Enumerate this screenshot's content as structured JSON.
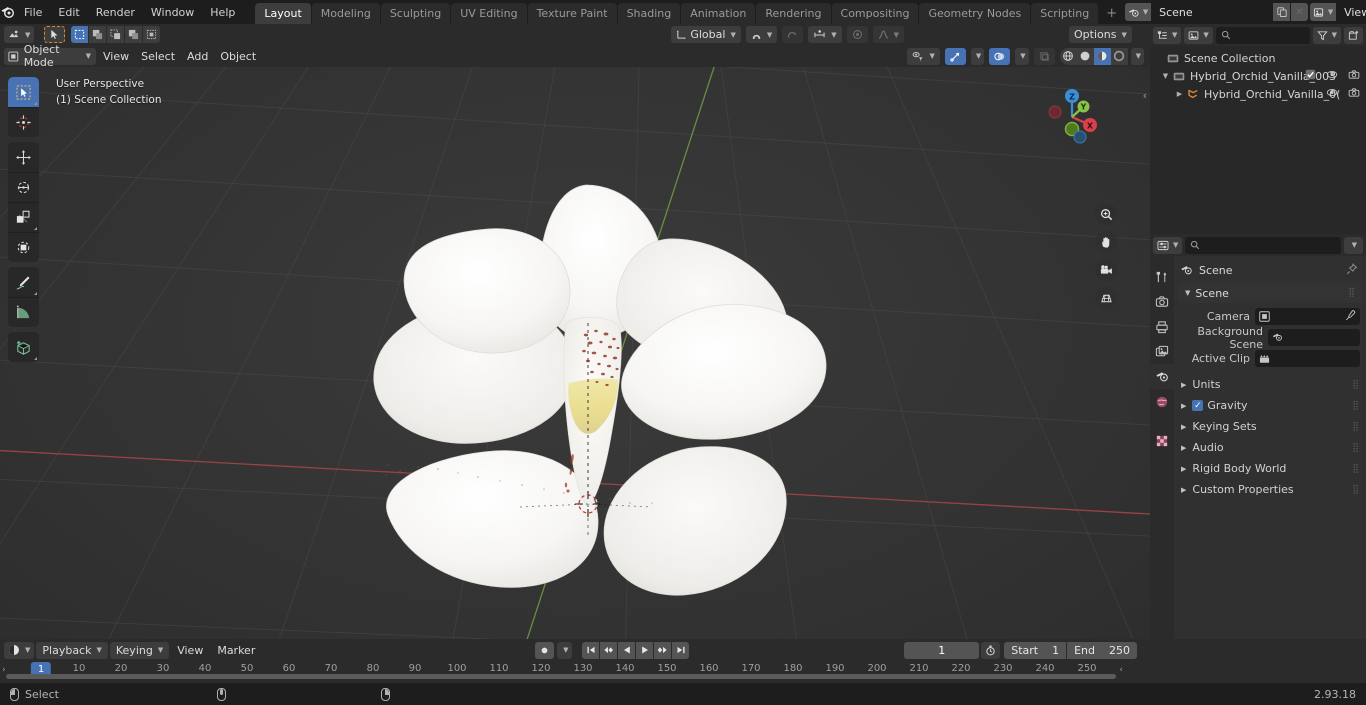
{
  "app": {
    "name": "Blender",
    "version": "2.93.18"
  },
  "topbar": {
    "menus": [
      "File",
      "Edit",
      "Render",
      "Window",
      "Help"
    ],
    "workspace_tabs": [
      {
        "label": "Layout",
        "active": true
      },
      {
        "label": "Modeling",
        "active": false
      },
      {
        "label": "Sculpting",
        "active": false
      },
      {
        "label": "UV Editing",
        "active": false
      },
      {
        "label": "Texture Paint",
        "active": false
      },
      {
        "label": "Shading",
        "active": false
      },
      {
        "label": "Animation",
        "active": false
      },
      {
        "label": "Rendering",
        "active": false
      },
      {
        "label": "Compositing",
        "active": false
      },
      {
        "label": "Geometry Nodes",
        "active": false
      },
      {
        "label": "Scripting",
        "active": false
      },
      {
        "label": "+",
        "active": false
      }
    ],
    "scene_name": "Scene",
    "view_layer_name": "View Layer"
  },
  "viewport_header": {
    "mode": "Object Mode",
    "menus": [
      "View",
      "Select",
      "Add",
      "Object"
    ],
    "transform_orientation": "Global",
    "options_label": "Options"
  },
  "viewport": {
    "perspective_label": "User Perspective",
    "collection_label": "(1) Scene Collection",
    "gizmo_axes": [
      "X",
      "Y",
      "Z"
    ],
    "axis_colors": {
      "x": "#d9414c",
      "y": "#8bc34a",
      "z": "#3b8fd9"
    }
  },
  "toolbar": {
    "tools": [
      {
        "name": "tweak-select-box",
        "active": true
      },
      {
        "name": "cursor",
        "active": false
      },
      {
        "name": "move",
        "active": false
      },
      {
        "name": "rotate",
        "active": false
      },
      {
        "name": "scale",
        "active": false
      },
      {
        "name": "transform",
        "active": false
      },
      {
        "name": "annotate",
        "active": false
      },
      {
        "name": "measure",
        "active": false
      },
      {
        "name": "add-cube",
        "active": false
      }
    ]
  },
  "outliner": {
    "search_placeholder": "",
    "rows": [
      {
        "label": "Scene Collection",
        "indent": 0,
        "icon": "collection",
        "expandable": false,
        "checkbox": false,
        "eye": false,
        "camera": false
      },
      {
        "label": "Hybrid_Orchid_Vanilla_003",
        "indent": 1,
        "icon": "collection",
        "expandable": true,
        "expanded": true,
        "checkbox": true,
        "eye": true,
        "camera": true
      },
      {
        "label": "Hybrid_Orchid_Vanilla_0(",
        "indent": 2,
        "icon": "mesh",
        "expandable": true,
        "expanded": false,
        "checkbox": false,
        "eye": true,
        "camera": true
      }
    ]
  },
  "properties": {
    "tabs": [
      {
        "name": "tool",
        "active": false
      },
      {
        "name": "render",
        "active": false
      },
      {
        "name": "output",
        "active": false
      },
      {
        "name": "view-layer",
        "active": false
      },
      {
        "name": "scene",
        "active": true
      },
      {
        "name": "world",
        "active": false
      },
      {
        "name": "texture",
        "active": false
      }
    ],
    "breadcrumb": "Scene",
    "panels": [
      {
        "label": "Scene",
        "expanded": true,
        "checkbox": false
      },
      {
        "label": "Units",
        "expanded": false,
        "checkbox": false
      },
      {
        "label": "Gravity",
        "expanded": false,
        "checkbox": true,
        "checked": true
      },
      {
        "label": "Keying Sets",
        "expanded": false,
        "checkbox": false
      },
      {
        "label": "Audio",
        "expanded": false,
        "checkbox": false
      },
      {
        "label": "Rigid Body World",
        "expanded": false,
        "checkbox": false
      },
      {
        "label": "Custom Properties",
        "expanded": false,
        "checkbox": false
      }
    ],
    "scene_fields": [
      {
        "label": "Camera",
        "value": "",
        "icon": "camera",
        "eyedropper": true
      },
      {
        "label": "Background Scene",
        "value": "",
        "icon": "scene",
        "eyedropper": false
      },
      {
        "label": "Active Clip",
        "value": "",
        "icon": "clip",
        "eyedropper": false
      }
    ]
  },
  "timeline": {
    "menus": [
      "Playback",
      "Keying",
      "View",
      "Marker"
    ],
    "current_frame": "1",
    "start_label": "Start",
    "start_value": "1",
    "end_label": "End",
    "end_value": "250",
    "ticks": [
      10,
      20,
      30,
      40,
      50,
      60,
      70,
      80,
      90,
      100,
      110,
      120,
      130,
      140,
      150,
      160,
      170,
      180,
      190,
      200,
      210,
      220,
      230,
      240,
      250
    ],
    "playhead_frame": "1"
  },
  "statusbar": {
    "select_label": "Select",
    "version": "2.93.18"
  }
}
